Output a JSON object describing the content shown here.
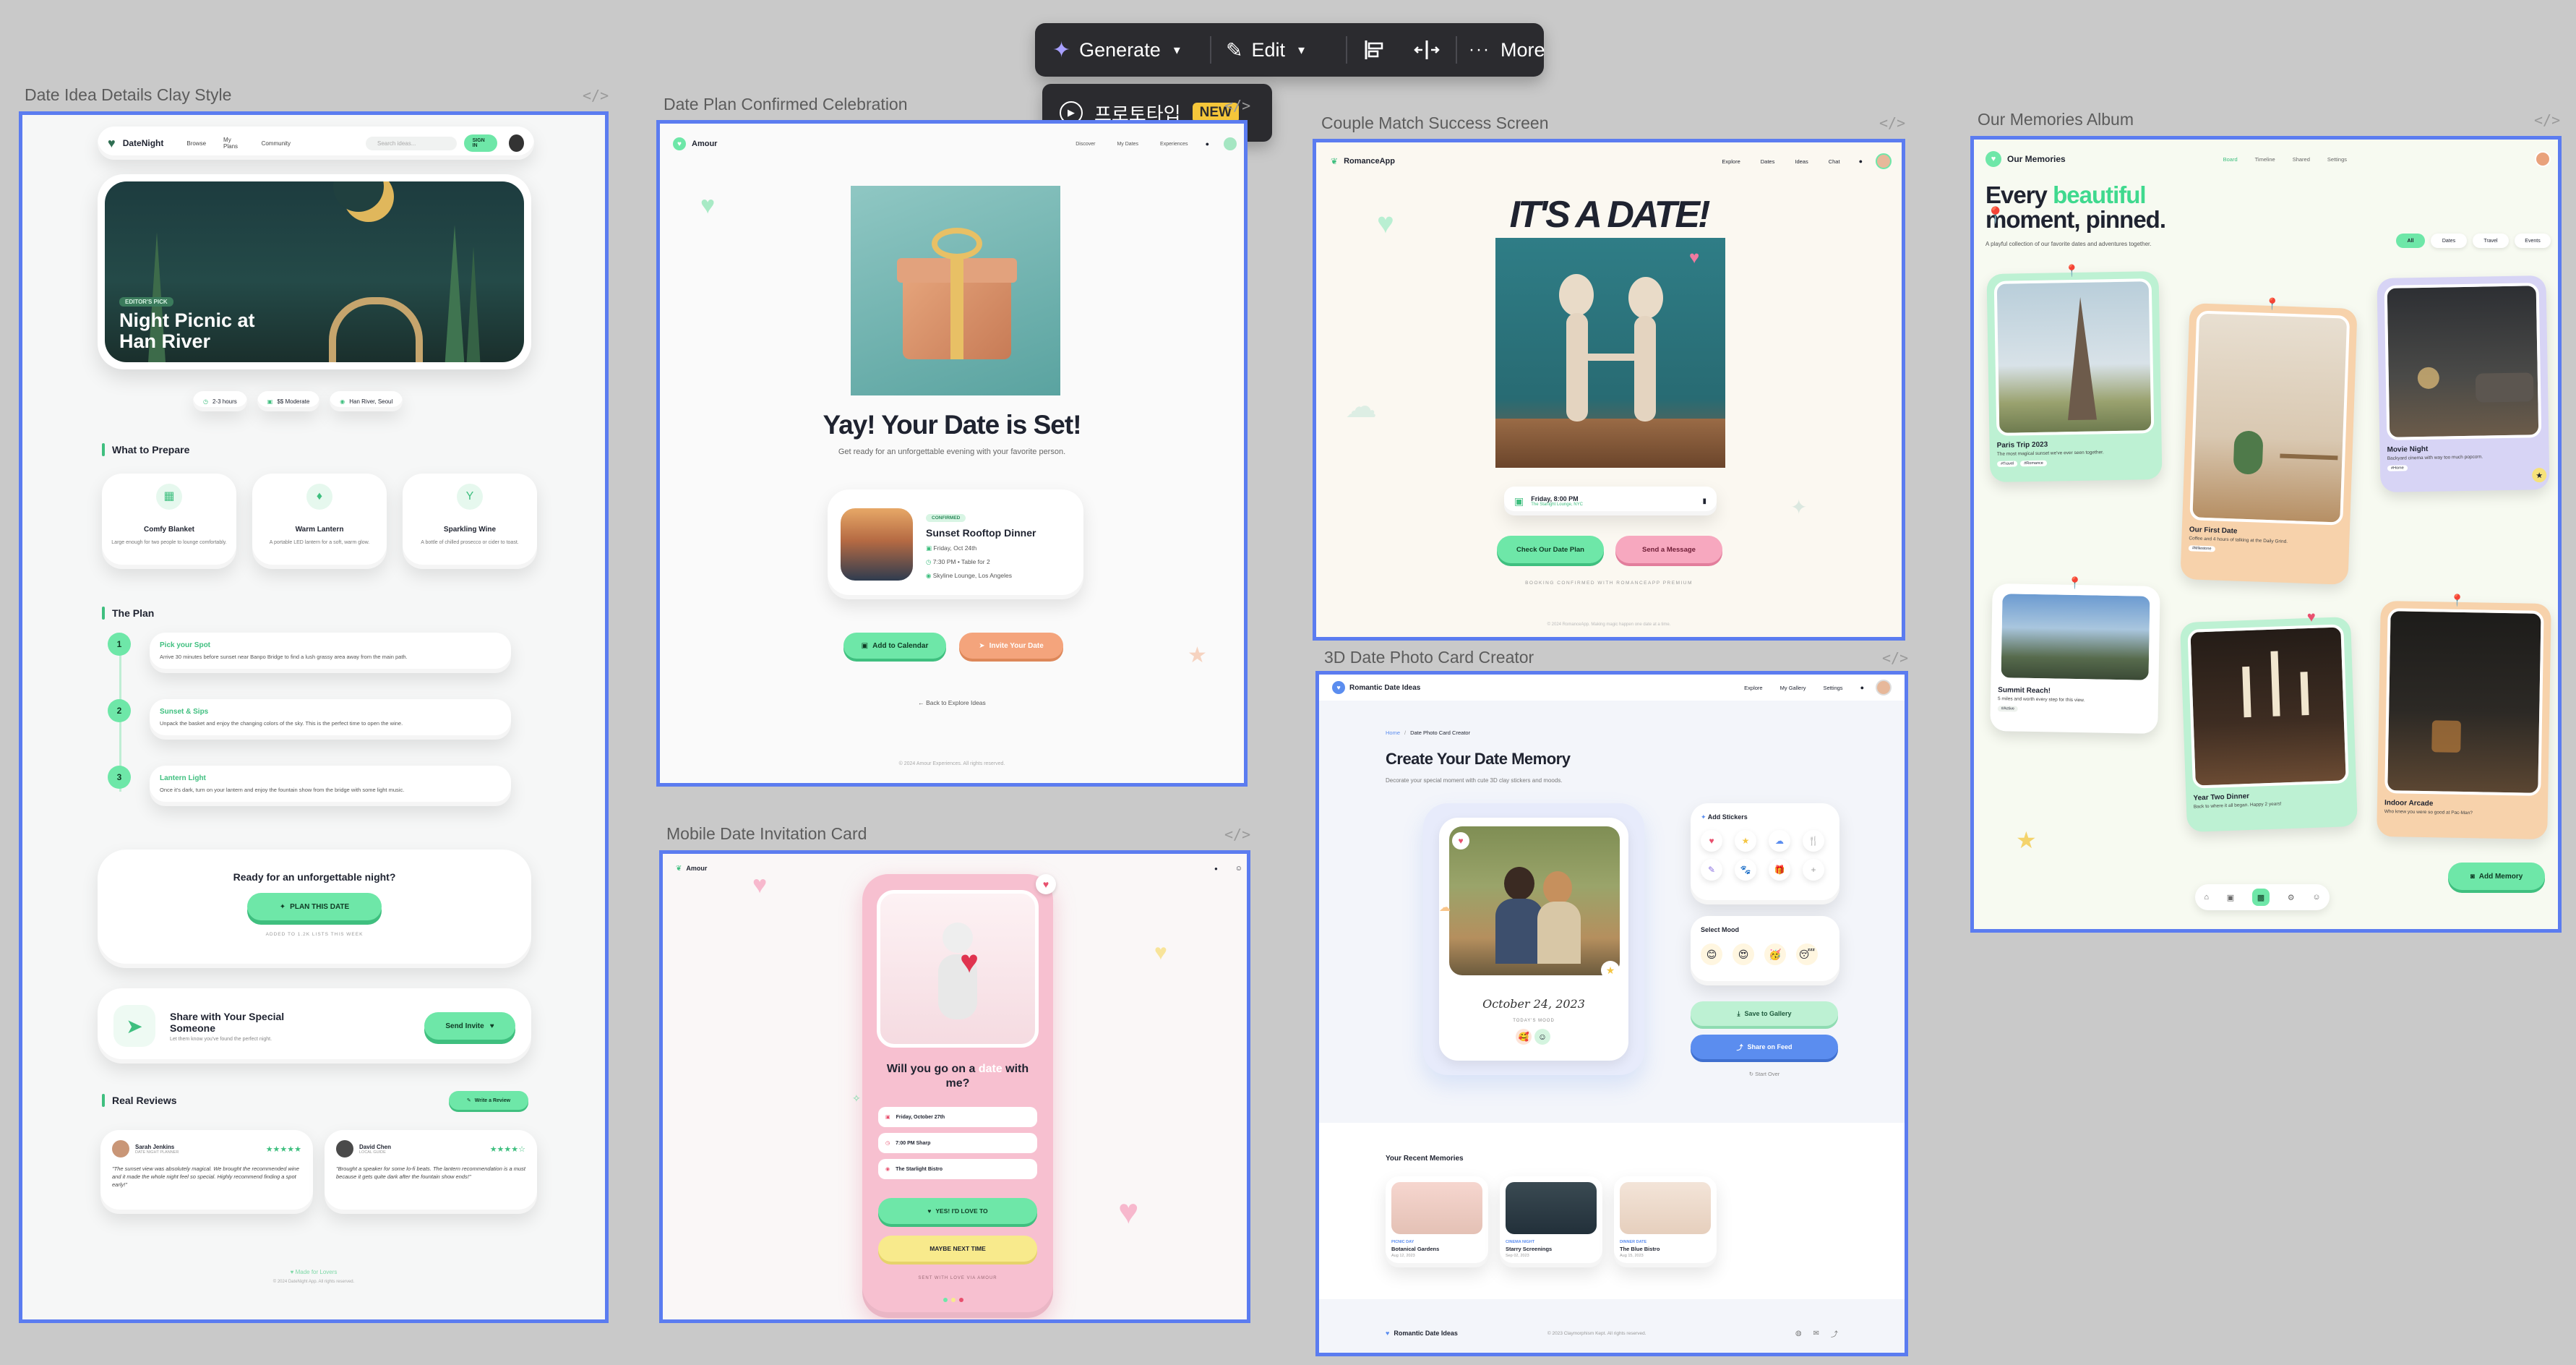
{
  "toolbar": {
    "generate": "Generate",
    "edit": "Edit",
    "more": "More",
    "prototype": "프로토타입",
    "badge": "NEW"
  },
  "code_icon": "</>",
  "frames": {
    "f1": "Date Idea Details Clay Style",
    "f2": "Date Plan Confirmed Celebration",
    "f3": "Couple Match Success Screen",
    "f4": "Our Memories Album",
    "f5": "Mobile Date Invitation Card",
    "f6": "3D Date Photo Card Creator"
  },
  "s1": {
    "brand": "DateNight",
    "nav": [
      "Browse",
      "My Plans",
      "Community"
    ],
    "search": "Search ideas...",
    "signin": "SIGN IN",
    "hero_tag": "EDITOR'S PICK",
    "hero_title": "Night Picnic at Han River",
    "chips": [
      "2-3 hours",
      "$$ Moderate",
      "Han River, Seoul"
    ],
    "prepare_title": "What to Prepare",
    "prepare": [
      {
        "name": "Comfy Blanket",
        "desc": "Large enough for two people to lounge comfortably."
      },
      {
        "name": "Warm Lantern",
        "desc": "A portable LED lantern for a soft, warm glow."
      },
      {
        "name": "Sparkling Wine",
        "desc": "A bottle of chilled prosecco or cider to toast."
      }
    ],
    "plan_title": "The Plan",
    "plan": [
      {
        "n": "1",
        "title": "Pick your Spot",
        "desc": "Arrive 30 minutes before sunset near Banpo Bridge to find a lush grassy area away from the main path."
      },
      {
        "n": "2",
        "title": "Sunset & Sips",
        "desc": "Unpack the basket and enjoy the changing colors of the sky. This is the perfect time to open the wine."
      },
      {
        "n": "3",
        "title": "Lantern Light",
        "desc": "Once it's dark, turn on your lantern and enjoy the fountain show from the bridge with some light music."
      }
    ],
    "cta_q": "Ready for an unforgettable night?",
    "cta_btn": "PLAN THIS DATE",
    "cta_sub": "ADDED TO 1.2K LISTS THIS WEEK",
    "share_title": "Share with Your Special Someone",
    "share_sub": "Let them know you've found the perfect night.",
    "share_btn": "Send Invite",
    "reviews_title": "Real Reviews",
    "write_review": "Write a Review",
    "reviews": [
      {
        "name": "Sarah Jenkins",
        "role": "DATE NIGHT PLANNER",
        "stars": "★★★★★",
        "text": "\"The sunset view was absolutely magical. We brought the recommended wine and it made the whole night feel so special. Highly recommend finding a spot early!\""
      },
      {
        "name": "David Chen",
        "role": "LOCAL GUIDE",
        "stars": "★★★★☆",
        "text": "\"Brought a speaker for some lo-fi beats. The lantern recommendation is a must because it gets quite dark after the fountain show ends!\""
      }
    ],
    "footer_brand": "Made for Lovers",
    "footer_copy": "© 2024 DateNight App. All rights reserved."
  },
  "s2": {
    "brand": "Amour",
    "nav": [
      "Discover",
      "My Dates",
      "Experiences"
    ],
    "title": "Yay! Your Date is Set!",
    "sub": "Get ready for an unforgettable evening with your favorite person.",
    "tag": "CONFIRMED",
    "venue": "Sunset Rooftop Dinner",
    "date": "Friday, Oct 24th",
    "time": "7:30 PM • Table for 2",
    "place": "Skyline Lounge, Los Angeles",
    "btn_cal": "Add to Calendar",
    "btn_invite": "Invite Your Date",
    "back": "Back to Explore Ideas",
    "copy": "© 2024 Amour Experiences. All rights reserved."
  },
  "s3": {
    "brand": "RomanceApp",
    "nav": [
      "Explore",
      "Dates",
      "Ideas",
      "Chat"
    ],
    "title": "IT'S A DATE!",
    "date": "Friday, 8:00 PM",
    "place": "The Starlight Lounge, NYC",
    "btn1": "Check Our Date Plan",
    "btn2": "Send a Message",
    "foot": "BOOKING CONFIRMED WITH ROMANCEAPP PREMIUM",
    "copy": "© 2024 RomanceApp. Making magic happen one date at a time."
  },
  "s4": {
    "brand": "Our Memories",
    "nav": [
      "Board",
      "Timeline",
      "Shared",
      "Settings"
    ],
    "title_a": "Every ",
    "title_b": "beautiful",
    "title_c": "moment, pinned.",
    "sub": "A playful collection of our favorite dates and adventures together.",
    "filters": [
      "All",
      "Dates",
      "Travel",
      "Events"
    ],
    "cards": [
      {
        "title": "Paris Trip 2023",
        "desc": "The most magical sunset we've ever seen together.",
        "tags": [
          "#Travel",
          "#Romance"
        ]
      },
      {
        "title": "Our First Date",
        "desc": "Coffee and 4 hours of talking at the Daily Grind.",
        "tags": [
          "#Milestone"
        ]
      },
      {
        "title": "Movie Night",
        "desc": "Backyard cinema with way too much popcorn.",
        "tags": [
          "#Home"
        ]
      },
      {
        "title": "Summit Reach!",
        "desc": "5 miles and worth every step for this view.",
        "tags": [
          "#Active"
        ]
      },
      {
        "title": "Year Two Dinner",
        "desc": "Back to where it all began. Happy 2 years!",
        "tags": []
      },
      {
        "title": "Indoor Arcade",
        "desc": "Who knew you were so good at Pac-Man?",
        "tags": []
      }
    ],
    "add": "Add Memory"
  },
  "s5": {
    "brand": "Amour",
    "q_a": "Will you go on a ",
    "q_b": "date",
    "q_c": " with me?",
    "rows": [
      "Friday, October 27th",
      "7:00 PM Sharp",
      "The Starlight Bistro"
    ],
    "yes": "YES! I'D LOVE TO",
    "maybe": "MAYBE NEXT TIME",
    "foot": "SENT WITH LOVE VIA AMOUR"
  },
  "s6": {
    "brand": "Romantic Date Ideas",
    "nav": [
      "Explore",
      "My Gallery",
      "Settings"
    ],
    "crumb_home": "Home",
    "crumb_sep": "/",
    "crumb_page": "Date Photo Card Creator",
    "title": "Create Your Date Memory",
    "sub": "Decorate your special moment with cute 3D clay stickers and moods.",
    "photo_date": "October 24, 2023",
    "mood_label": "TODAY'S MOOD",
    "stickers_title": "Add Stickers",
    "stickers": [
      "♥",
      "★",
      "☁",
      "🍴",
      "✎",
      "🐾",
      "🎁",
      "+"
    ],
    "mood_title": "Select Mood",
    "moods": [
      "😊",
      "😍",
      "🥳",
      "😴"
    ],
    "save": "Save to Gallery",
    "share": "Share on Feed",
    "start": "Start Over",
    "recent_title": "Your Recent Memories",
    "recent": [
      {
        "tag": "PICNIC DAY",
        "name": "Botanical Gardens",
        "date": "Aug 12, 2023"
      },
      {
        "tag": "CINEMA NIGHT",
        "name": "Starry Screenings",
        "date": "Sep 02, 2023"
      },
      {
        "tag": "DINNER DATE",
        "name": "The Blue Bistro",
        "date": "Aug 15, 2023"
      }
    ],
    "footer_brand": "Romantic Date Ideas",
    "footer_copy": "© 2023 Claymorphism Kept. All rights reserved."
  },
  "colors": {
    "frame": "#5b7cf0",
    "green": "#6ee7a8",
    "pink": "#f38fae",
    "peach": "#f4a47c",
    "blue": "#5b8def",
    "dark": "#2b2b2f"
  }
}
